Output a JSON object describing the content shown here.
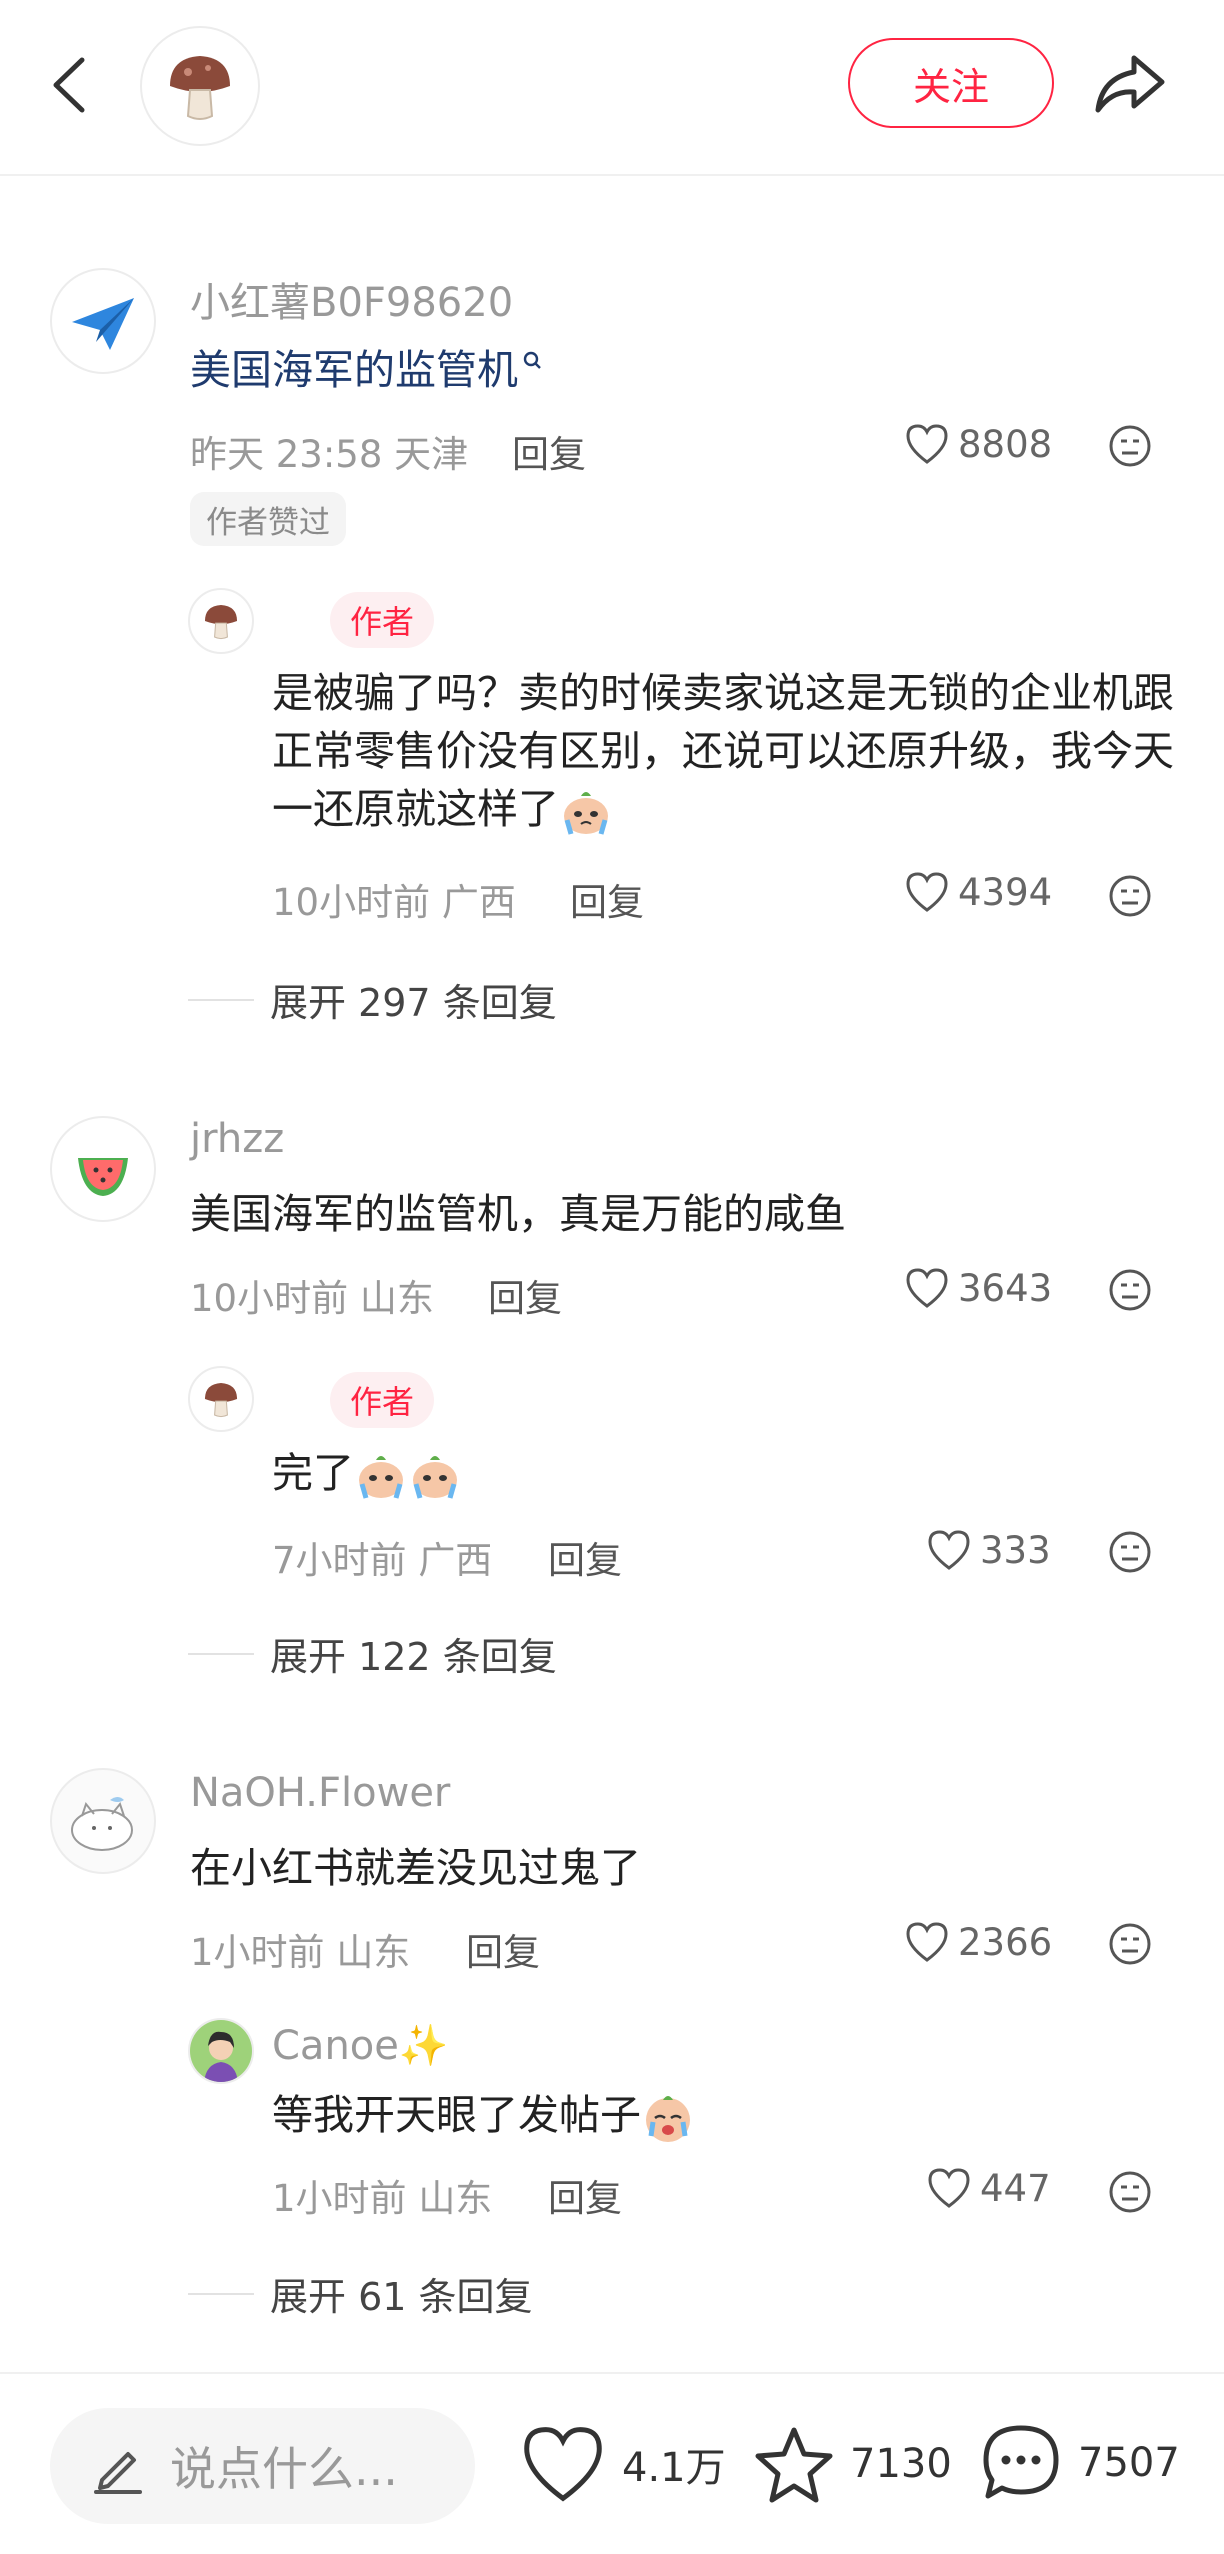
{
  "header": {
    "follow_label": "关注",
    "icons": {
      "back": "chevron-left-icon",
      "share": "share-arrow-icon",
      "avatar": "mushroom-avatar"
    }
  },
  "comments": [
    {
      "username": "小红薯B0F98620",
      "text": "美国海军的监管机",
      "time": "昨天 23:58",
      "location": "天津",
      "reply_label": "回复",
      "likes": "8808",
      "badge": "作者赞过",
      "avatar_icon": "paper-plane-avatar",
      "sub_reply": {
        "badge": "作者",
        "text": "是被骗了吗？卖的时候卖家说这是无锁的企业机跟正常零售价没有区别，还说可以还原升级，我今天一还原就这样了",
        "time": "10小时前",
        "location": "广西",
        "reply_label": "回复",
        "likes": "4394"
      },
      "expand_label": "展开 297 条回复"
    },
    {
      "username": "jrhzz",
      "text": "美国海军的监管机，真是万能的咸鱼",
      "time": "10小时前",
      "location": "山东",
      "reply_label": "回复",
      "likes": "3643",
      "avatar_icon": "watermelon-avatar",
      "sub_reply": {
        "badge": "作者",
        "text": "完了",
        "time": "7小时前",
        "location": "广西",
        "reply_label": "回复",
        "likes": "333"
      },
      "expand_label": "展开 122 条回复"
    },
    {
      "username": "NaOH.Flower",
      "text": "在小红书就差没见过鬼了",
      "time": "1小时前",
      "location": "山东",
      "reply_label": "回复",
      "likes": "2366",
      "avatar_icon": "cat-sketch-avatar",
      "sub_reply": {
        "username": "Canoe✨",
        "text": "等我开天眼了发帖子",
        "time": "1小时前",
        "location": "山东",
        "reply_label": "回复",
        "likes": "447"
      },
      "expand_label": "展开 61 条回复"
    }
  ],
  "bottom_bar": {
    "input_placeholder": "说点什么...",
    "likes": "4.1万",
    "stars": "7130",
    "comments": "7507"
  },
  "colors": {
    "accent": "#ff2442",
    "link_blue": "#1f3b6e",
    "meta_gray": "#999999"
  }
}
